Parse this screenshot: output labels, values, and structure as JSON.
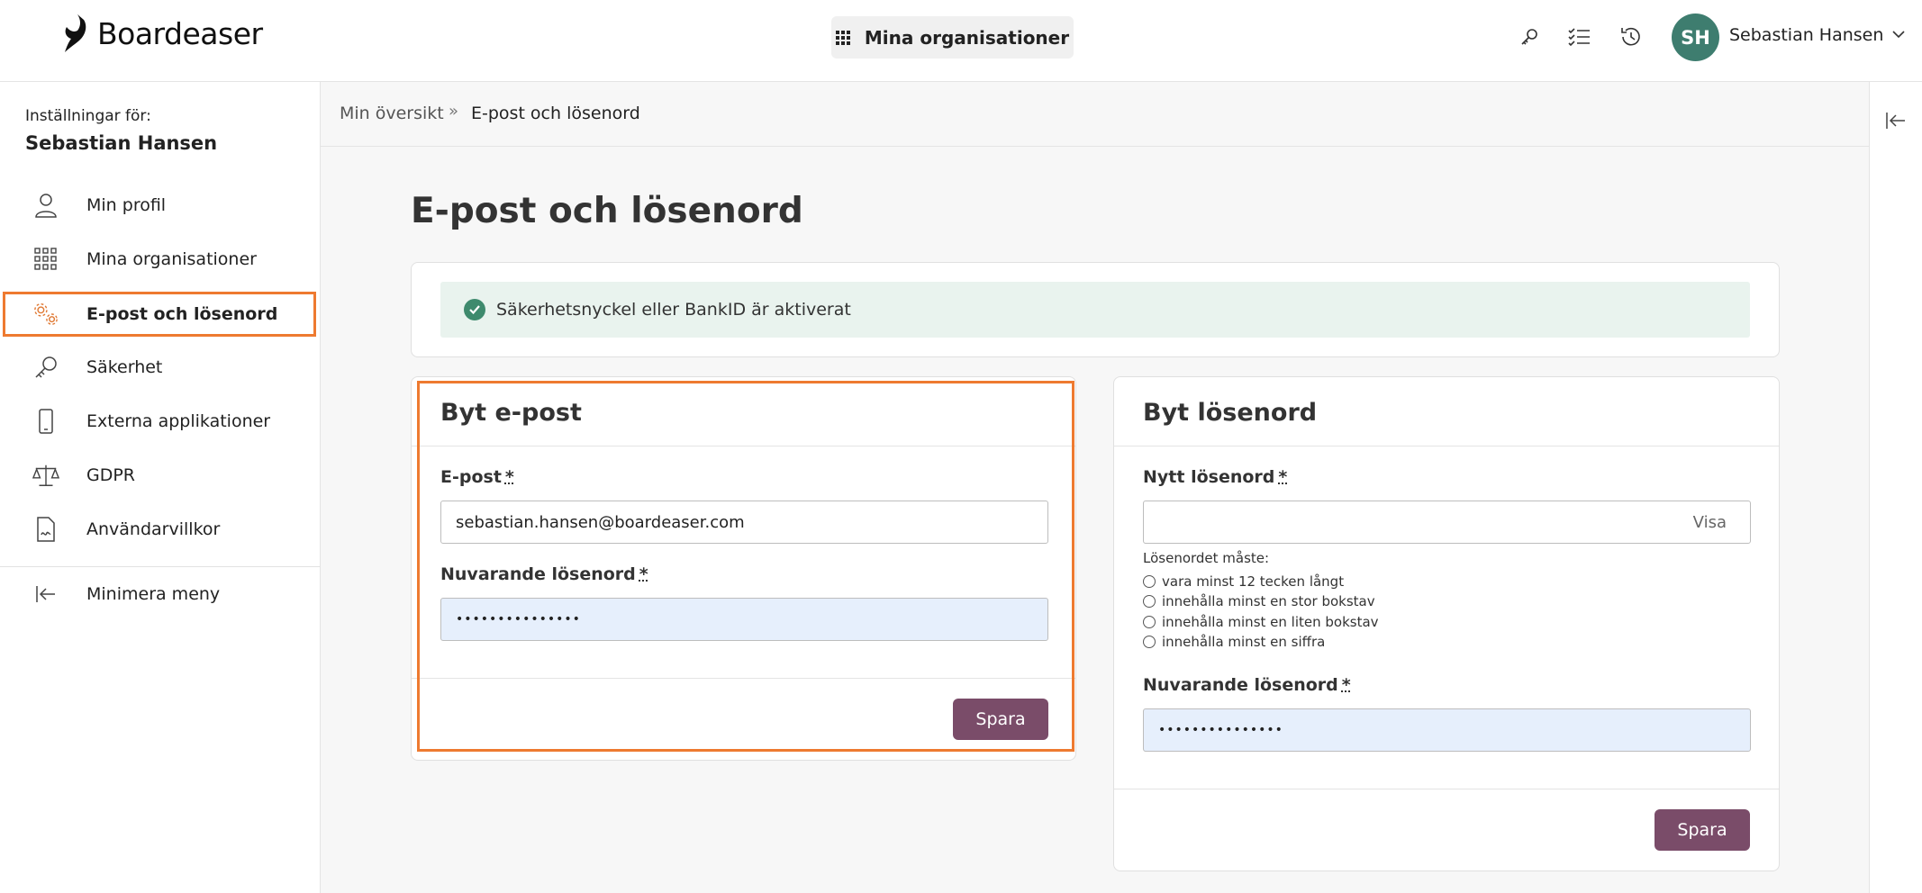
{
  "header": {
    "logo_text": "Boardeaser",
    "org_button_label": "Mina organisationer",
    "user_initials": "SH",
    "user_name": "Sebastian Hansen"
  },
  "sidebar": {
    "settings_for_label": "Inställningar för:",
    "settings_user": "Sebastian Hansen",
    "items": [
      {
        "label": "Min profil",
        "icon": "user-icon"
      },
      {
        "label": "Mina organisationer",
        "icon": "grid-icon"
      },
      {
        "label": "E-post och lösenord",
        "icon": "gears-icon",
        "active": true
      },
      {
        "label": "Säkerhet",
        "icon": "key-icon"
      },
      {
        "label": "Externa applikationer",
        "icon": "phone-icon"
      },
      {
        "label": "GDPR",
        "icon": "scale-icon"
      },
      {
        "label": "Användarvillkor",
        "icon": "document-icon"
      }
    ],
    "minimize_label": "Minimera meny"
  },
  "breadcrumb": {
    "home": "Min översikt",
    "separator": "»",
    "current": "E-post och lösenord"
  },
  "page": {
    "title": "E-post och lösenord",
    "alert_text": "Säkerhetsnyckel eller BankID är aktiverat"
  },
  "email_form": {
    "title": "Byt e-post",
    "email_label": "E-post",
    "email_value": "sebastian.hansen@boardeaser.com",
    "current_pwd_label": "Nuvarande lösenord",
    "current_pwd_value": "•••••••••••••••",
    "required_mark": "*",
    "save_label": "Spara"
  },
  "password_form": {
    "title": "Byt lösenord",
    "new_pwd_label": "Nytt lösenord",
    "new_pwd_value": "",
    "show_label": "Visa",
    "rules_title": "Lösenordet måste:",
    "rules": [
      "vara minst 12 tecken långt",
      "innehålla minst en stor bokstav",
      "innehålla minst en liten bokstav",
      "innehålla minst en siffra"
    ],
    "current_pwd_label": "Nuvarande lösenord",
    "current_pwd_value": "•••••••••••••••",
    "required_mark": "*",
    "save_label": "Spara"
  },
  "colors": {
    "accent": "#7a4c69",
    "avatar": "#3e7d6f",
    "highlight": "#ee7a30",
    "success": "#3e8a6d",
    "alert_bg": "#e9f3ee"
  }
}
